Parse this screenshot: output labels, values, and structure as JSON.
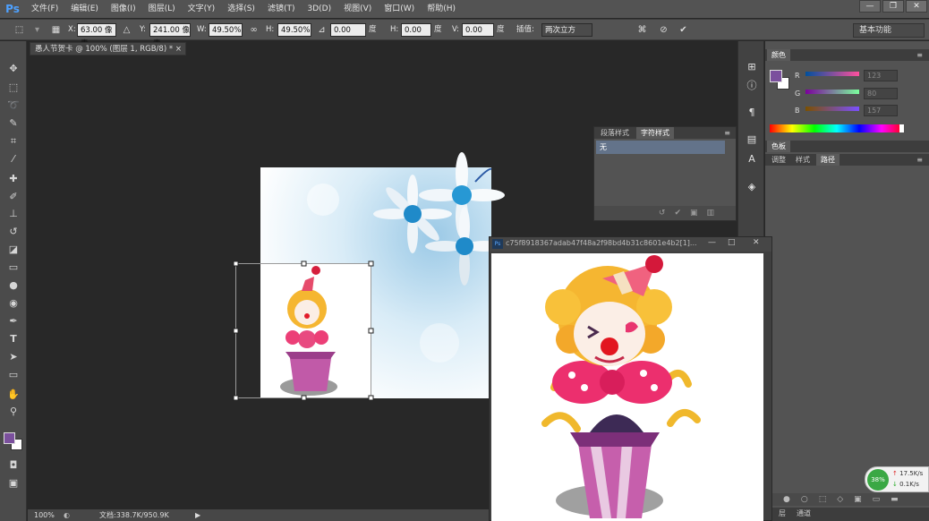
{
  "app": {
    "logo": "Ps"
  },
  "menu": [
    "文件(F)",
    "编辑(E)",
    "图像(I)",
    "图层(L)",
    "文字(Y)",
    "选择(S)",
    "滤镜(T)",
    "3D(D)",
    "视图(V)",
    "窗口(W)",
    "帮助(H)"
  ],
  "options": {
    "x_label": "X:",
    "x_value": "63.00 像素",
    "y_label": "Y:",
    "y_value": "241.00 像素",
    "w_label": "W:",
    "w_value": "49.50%",
    "h_label": "H:",
    "h_value": "49.50%",
    "angle_value": "0.00",
    "angle_unit": "度",
    "hskew_label": "H:",
    "hskew_value": "0.00",
    "hskew_unit": "度",
    "vskew_label": "V:",
    "vskew_value": "0.00",
    "vskew_unit": "度",
    "interp_label": "插值:",
    "interp_value": "两次立方",
    "workspace": "基本功能"
  },
  "document": {
    "tab_title": "愚人节贺卡 @ 100% (图层 1, RGB/8) *",
    "close": "×"
  },
  "status": {
    "zoom": "100%",
    "doc_info": "文档:338.7K/950.9K"
  },
  "char_panel": {
    "tabs": [
      "段落样式",
      "字符样式"
    ],
    "active_tab": 1,
    "item": "无"
  },
  "color_panel": {
    "title": "颜色",
    "r_label": "R",
    "r_value": "123",
    "g_label": "G",
    "g_value": "80",
    "b_label": "B",
    "b_value": "157",
    "foreground": "#7b509d"
  },
  "swatch_panel": {
    "title": "色板",
    "tabs": [
      "调整",
      "样式",
      "路径"
    ],
    "active_tab": 2
  },
  "bottom_tabs": [
    "层",
    "通道"
  ],
  "image_window": {
    "title": "c75f8918367adab47f48a2f98bd4b31c8601e4b2[1]...",
    "min": "—",
    "max": "□",
    "close": "✕"
  },
  "network": {
    "percent": "38%",
    "up": "17.5K/s",
    "down": "0.1K/s"
  }
}
